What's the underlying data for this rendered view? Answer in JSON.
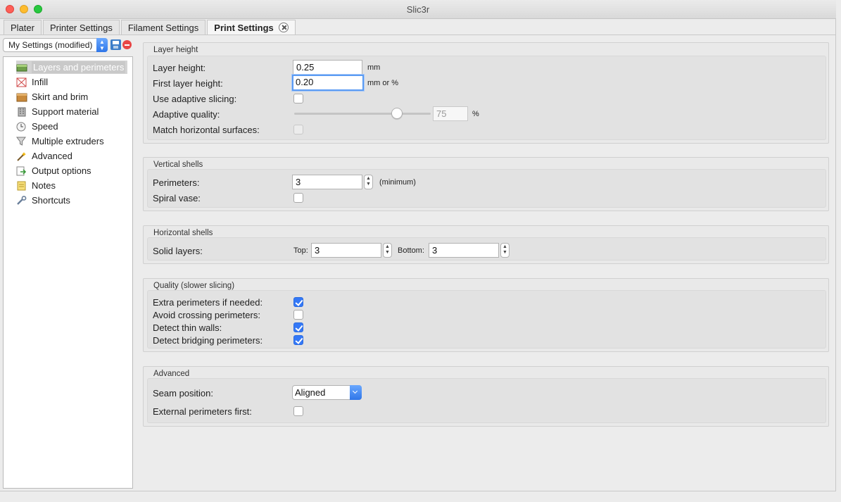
{
  "window": {
    "title": "Slic3r"
  },
  "tabs": [
    {
      "label": "Plater"
    },
    {
      "label": "Printer Settings"
    },
    {
      "label": "Filament Settings"
    },
    {
      "label": "Print Settings"
    }
  ],
  "preset": {
    "selected": "My Settings (modified)"
  },
  "sidebar": {
    "items": [
      {
        "label": "Layers and perimeters",
        "icon": "layers-icon"
      },
      {
        "label": "Infill",
        "icon": "infill-icon"
      },
      {
        "label": "Skirt and brim",
        "icon": "box-icon"
      },
      {
        "label": "Support material",
        "icon": "building-icon"
      },
      {
        "label": "Speed",
        "icon": "clock-icon"
      },
      {
        "label": "Multiple extruders",
        "icon": "funnel-icon"
      },
      {
        "label": "Advanced",
        "icon": "wand-icon"
      },
      {
        "label": "Output options",
        "icon": "page-export-icon"
      },
      {
        "label": "Notes",
        "icon": "note-icon"
      },
      {
        "label": "Shortcuts",
        "icon": "wrench-icon"
      }
    ]
  },
  "layer_height": {
    "title": "Layer height",
    "layer_height_label": "Layer height:",
    "layer_height_value": "0.25",
    "layer_height_unit": "mm",
    "first_layer_label": "First layer height:",
    "first_layer_value": "0.20",
    "first_layer_unit": "mm or %",
    "adaptive_slicing_label": "Use adaptive slicing:",
    "adaptive_slicing_checked": false,
    "adaptive_quality_label": "Adaptive quality:",
    "adaptive_quality_value": "75",
    "adaptive_quality_unit": "%",
    "adaptive_quality_level_percent": 75,
    "match_horizontal_label": "Match horizontal surfaces:",
    "match_horizontal_checked": false
  },
  "vertical_shells": {
    "title": "Vertical shells",
    "perimeters_label": "Perimeters:",
    "perimeters_value": "3",
    "perimeters_hint": "(minimum)",
    "spiral_vase_label": "Spiral vase:",
    "spiral_vase_checked": false
  },
  "horizontal_shells": {
    "title": "Horizontal shells",
    "solid_layers_label": "Solid layers:",
    "top_label": "Top:",
    "top_value": "3",
    "bottom_label": "Bottom:",
    "bottom_value": "3"
  },
  "quality": {
    "title": "Quality (slower slicing)",
    "extra_perimeters_label": "Extra perimeters if needed:",
    "extra_perimeters_checked": true,
    "avoid_crossing_label": "Avoid crossing perimeters:",
    "avoid_crossing_checked": false,
    "thin_walls_label": "Detect thin walls:",
    "thin_walls_checked": true,
    "bridging_label": "Detect bridging perimeters:",
    "bridging_checked": true
  },
  "advanced": {
    "title": "Advanced",
    "seam_label": "Seam position:",
    "seam_value": "Aligned",
    "external_first_label": "External perimeters first:",
    "external_first_checked": false
  },
  "colors": {
    "accent": "#3478f6",
    "selection": "#c9c9c9"
  }
}
